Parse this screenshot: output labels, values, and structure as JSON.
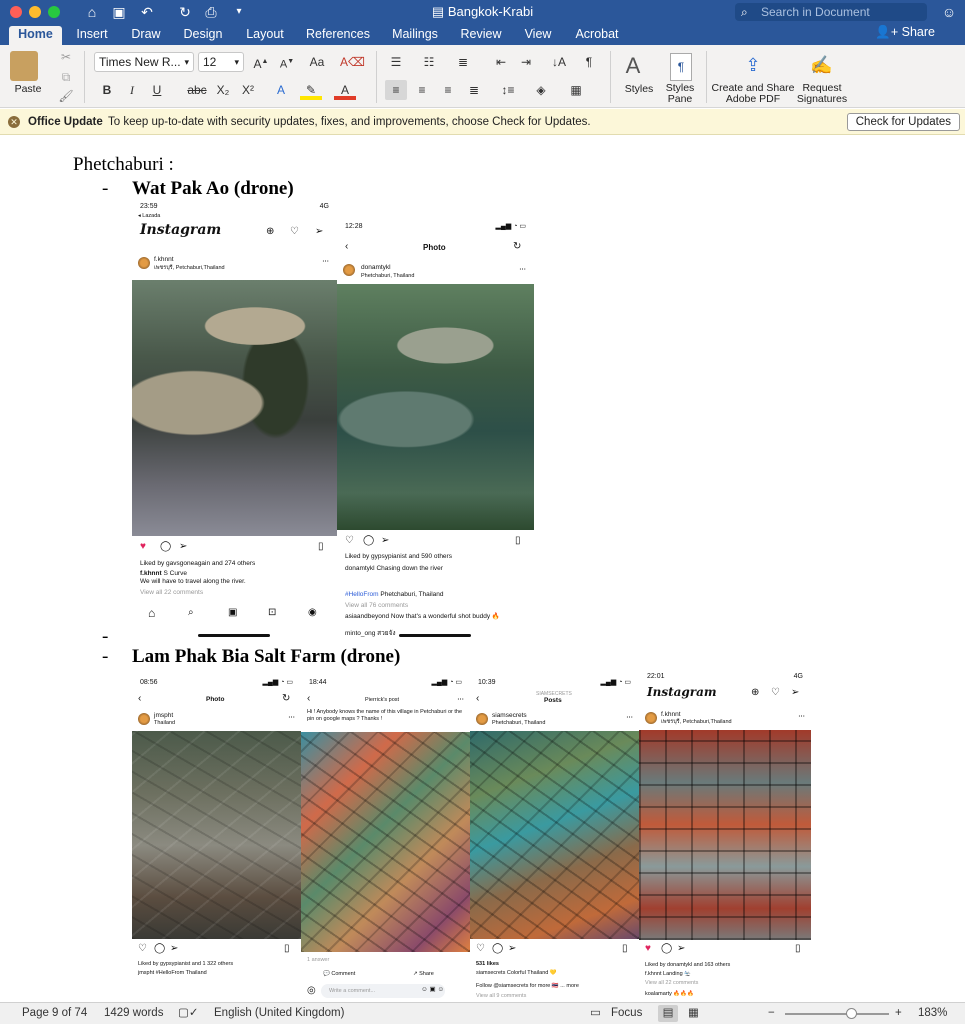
{
  "window": {
    "title": "Bangkok-Krabi",
    "search_placeholder": "Search in Document",
    "share_label": "Share"
  },
  "tabs": [
    "Home",
    "Insert",
    "Draw",
    "Design",
    "Layout",
    "References",
    "Mailings",
    "Review",
    "View",
    "Acrobat"
  ],
  "ribbon": {
    "paste_label": "Paste",
    "font_name": "Times New R...",
    "font_size": "12",
    "styles_label": "Styles",
    "styles_pane_label_1": "Styles",
    "styles_pane_label_2": "Pane",
    "create_pdf_label_1": "Create and Share",
    "create_pdf_label_2": "Adobe PDF",
    "request_sig_label_1": "Request",
    "request_sig_label_2": "Signatures",
    "bold": "B",
    "italic": "I",
    "underline": "U",
    "strike": "abc",
    "subscript": "X₂",
    "superscript": "X²"
  },
  "message_bar": {
    "title": "Office Update",
    "text": "To keep up-to-date with security updates, fixes, and improvements, choose Check for Updates.",
    "button": "Check for Updates"
  },
  "document": {
    "heading": "Phetchaburi :",
    "item1": "Wat Pak Ao (drone)",
    "item2": "Lam Phak Bia Salt Farm (drone)",
    "bullet": "-"
  },
  "shots": {
    "s1": {
      "time": "23:59",
      "back": "◂ Lazada",
      "signal": "4G",
      "app": "Instagram",
      "user": "f.khnnt",
      "location": "เพชรบุรี, Petchaburi,Thailand",
      "likes": "Liked by gavsgoneagain and 274 others",
      "caption_user": "f.khnnt",
      "caption": "S Curve",
      "caption2": "We will have to travel along the river.",
      "comments": "View all 22 comments"
    },
    "s2": {
      "time": "12:28",
      "title": "Photo",
      "user": "donamtykl",
      "location": "Phetchaburi, Thailand",
      "likes": "Liked by gypsypianist and 590 others",
      "caption_user": "donamtykl",
      "caption": "Chasing down the river",
      "hashtag": "#HelloFrom",
      "hashtag_rest": "Phetchaburi, Thailand",
      "comments": "View all 76 comments",
      "c1_user": "asiaandbeyond",
      "c1": "Now that's a wonderful shot buddy 🔥",
      "c2_user": "minto_ong",
      "c2": "สวยจัง"
    },
    "s3": {
      "time": "08:56",
      "title": "Photo",
      "user": "jmspht",
      "location": "Thailand",
      "likes": "Liked by gypsypianist and 1 322 others",
      "caption_user": "jmspht",
      "caption": "#HelloFrom Thailand"
    },
    "s4": {
      "time": "18:44",
      "title": "Pierrick's post",
      "post_text": "Hi ! Anybody knows the name of this village in Petchaburi or the pin on google maps ? Thanks !",
      "answers": "1 answer",
      "comment_btn": "Comment",
      "share_btn": "Share",
      "write": "Write a comment..."
    },
    "s5": {
      "time": "10:39",
      "account": "SIAMSECRETS",
      "title": "Posts",
      "user": "siamsecrets",
      "location": "Phetchaburi, Thailand",
      "likes": "531 likes",
      "caption_user": "siamsecrets",
      "caption": "Colorful Thailand 💛",
      "follow": "Follow @siamsecrets for more 🇹🇭 ... more",
      "comments": "View all 9 comments"
    },
    "s6": {
      "time": "22:01",
      "signal": "4G",
      "app": "Instagram",
      "user": "f.khnnt",
      "location": "เพชรบุรี, Petchaburi,Thailand",
      "likes": "Liked by donamtykl and 163 others",
      "caption_user": "f.khnnt",
      "caption": "Landing 🛬",
      "comments": "View all 22 comments",
      "c1": "koalamarty 🔥🔥🔥"
    }
  },
  "status": {
    "page": "Page 9 of 74",
    "words": "1429 words",
    "language": "English (United Kingdom)",
    "focus": "Focus",
    "zoom": "183%"
  }
}
